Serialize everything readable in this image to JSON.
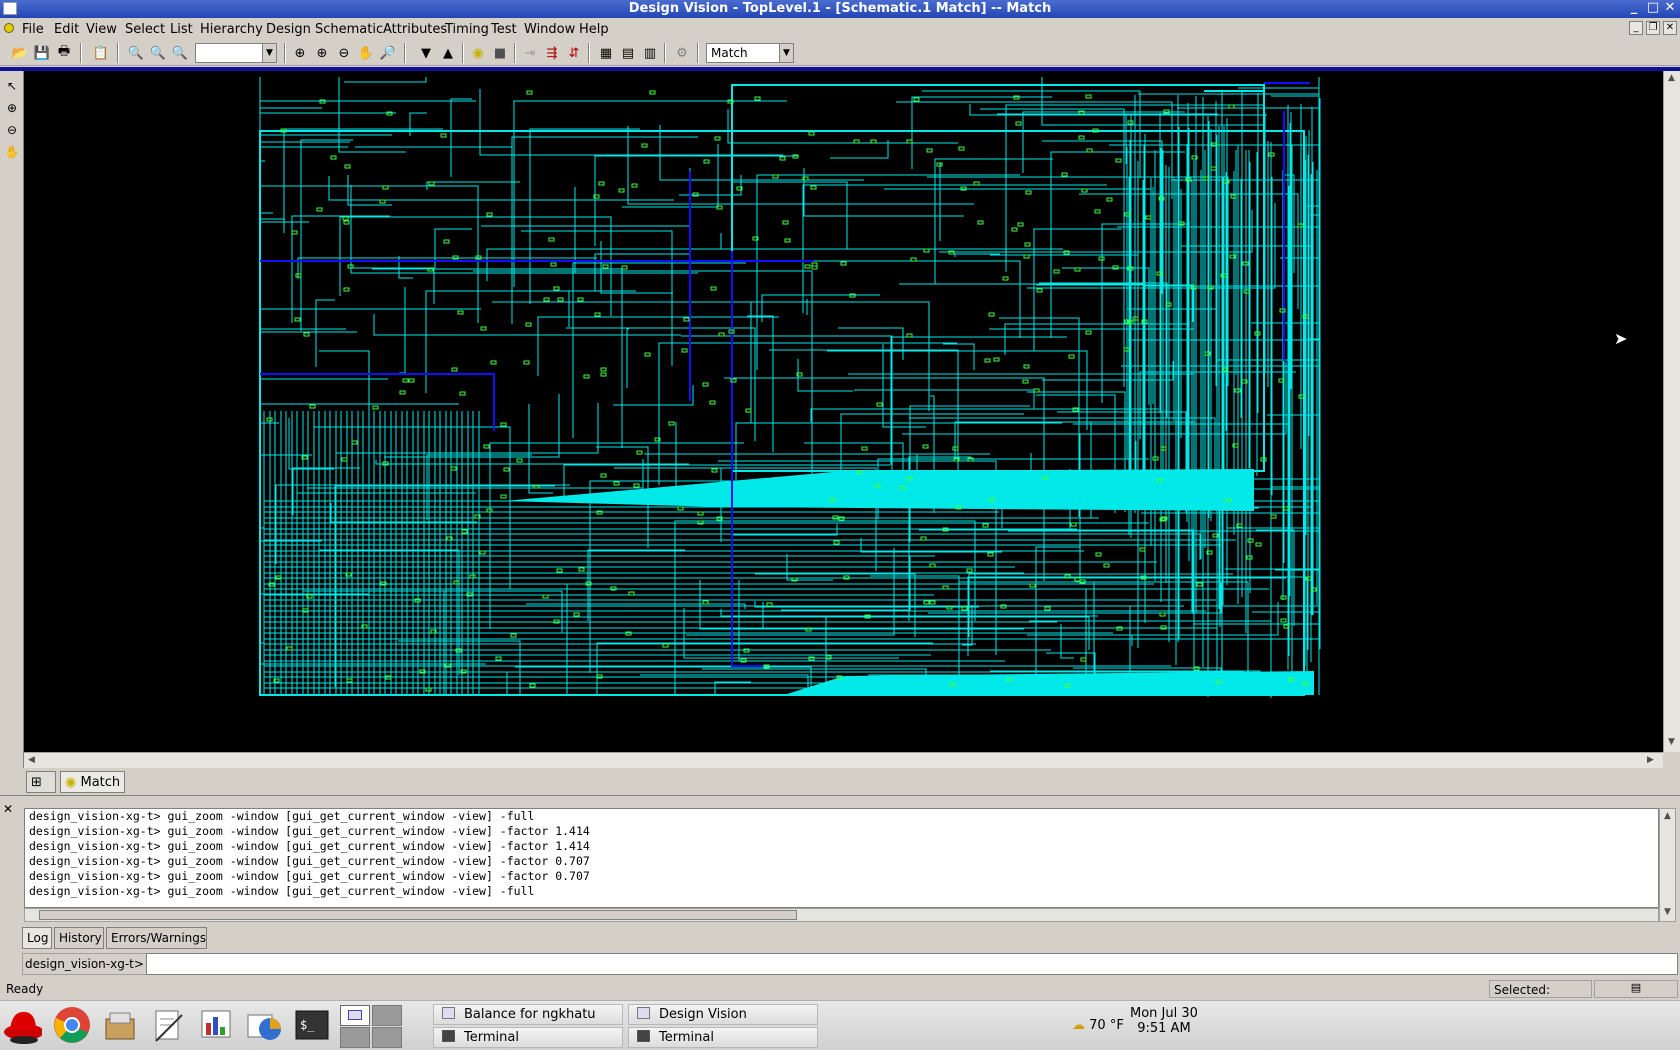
{
  "window": {
    "title": "Design Vision - TopLevel.1 - [Schematic.1   Match] -- Match",
    "controls": [
      "_",
      "□",
      "✕"
    ]
  },
  "menubar": {
    "items": [
      "File",
      "Edit",
      "View",
      "Select",
      "List",
      "Hierarchy",
      "Design",
      "Schematic",
      "Attributes",
      "Timing",
      "Test",
      "Window",
      "Help"
    ]
  },
  "toolbar": {
    "zoom_value": "",
    "design_select": "Match"
  },
  "colors": {
    "canvas_bg": "#000000",
    "wire": "#00e8e8",
    "bus": "#1010ff",
    "cell": "#40ff40",
    "titlebar": "#2446b4"
  },
  "window_tabs": {
    "hierarchy_icon": "hierarchy-icon",
    "active_tab": "Match"
  },
  "console": {
    "lines": [
      "design_vision-xg-t> gui_zoom -window [gui_get_current_window -view] -full",
      "design_vision-xg-t> gui_zoom -window [gui_get_current_window -view] -factor 1.414",
      "design_vision-xg-t> gui_zoom -window [gui_get_current_window -view] -factor 1.414",
      "design_vision-xg-t> gui_zoom -window [gui_get_current_window -view] -factor 0.707",
      "design_vision-xg-t> gui_zoom -window [gui_get_current_window -view] -factor 0.707",
      "design_vision-xg-t> gui_zoom -window [gui_get_current_window -view] -full"
    ],
    "tabs": [
      "Log",
      "History",
      "Errors/Warnings"
    ],
    "active_tab": "Log",
    "prompt": "design_vision-xg-t>",
    "input_value": ""
  },
  "status": {
    "ready": "Ready",
    "selected_label": "Selected:"
  },
  "taskbar": {
    "tasks_row1": [
      "Balance for ngkhatu",
      "Design Vision"
    ],
    "tasks_row2": [
      "Terminal",
      "Terminal"
    ],
    "weather": "70 °F",
    "date": "Mon Jul 30",
    "time": "9:51 AM"
  }
}
